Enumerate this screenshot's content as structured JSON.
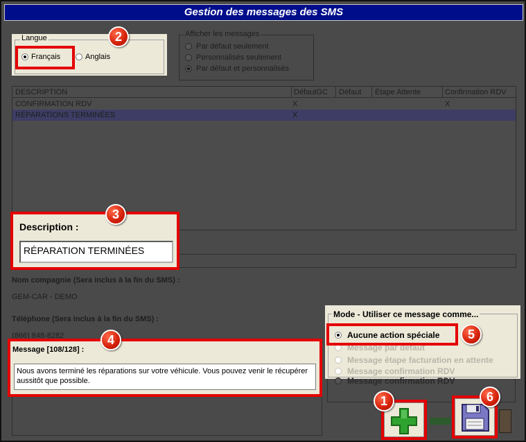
{
  "window": {
    "title": "Gestion des messages des SMS"
  },
  "langue": {
    "legend": "Langue",
    "options": [
      {
        "label": "Français",
        "selected": true
      },
      {
        "label": "Anglais",
        "selected": false
      }
    ]
  },
  "afficher": {
    "legend": "Afficher les messages",
    "options": [
      {
        "label": "Par défaut seulement",
        "selected": false
      },
      {
        "label": "Personnalisés seulement",
        "selected": false
      },
      {
        "label": "Par défaut et personnalisés",
        "selected": true
      }
    ]
  },
  "table": {
    "columns": [
      "DESCRIPTION",
      "DéfautGC",
      "Défaut",
      "Étape Attente",
      "Confirmation RDV"
    ],
    "rows": [
      {
        "description": "CONFIRMATION RDV",
        "defautgc": "X",
        "defaut": "",
        "etape": "",
        "confirmation": "X",
        "selected": false
      },
      {
        "description": "RÉPARATIONS TERMINÉES",
        "defautgc": "X",
        "defaut": "",
        "etape": "",
        "confirmation": "",
        "selected": true
      }
    ]
  },
  "description": {
    "label": "Description :",
    "value": "RÉPARATION TERMINÉES"
  },
  "company": {
    "label": "Nom compagnie (Sera inclus à la fin du SMS) :",
    "value": "GEM-CAR - DEMO"
  },
  "phone": {
    "label": "Téléphone (Sera inclus à la fin du SMS) :",
    "value": "(866) 848-8282"
  },
  "message": {
    "label": "Message [108/128] :",
    "value": "Nous avons terminé les réparations sur votre véhicule. Vous pouvez venir le récupérer aussitôt que possible."
  },
  "mode": {
    "legend": "Mode - Utiliser ce message comme...",
    "options": [
      {
        "label": "Aucune action spéciale",
        "selected": true
      },
      {
        "label": "Message par défaut",
        "selected": false
      },
      {
        "label": "Message étape facturation en attente",
        "selected": false
      },
      {
        "label": "Message confirmation RDV",
        "selected": false
      },
      {
        "label": "Message confirmation RDV",
        "selected": false
      }
    ]
  },
  "badges": [
    "1",
    "2",
    "3",
    "4",
    "5",
    "6"
  ],
  "icons": {
    "add": "plus-icon",
    "save": "floppy-disk-icon",
    "remove": "minus-icon",
    "delete": "trash-icon"
  },
  "colors": {
    "highlight": "#e40000",
    "titlebar": "#000d8a",
    "add_green": "#2fa32f"
  }
}
